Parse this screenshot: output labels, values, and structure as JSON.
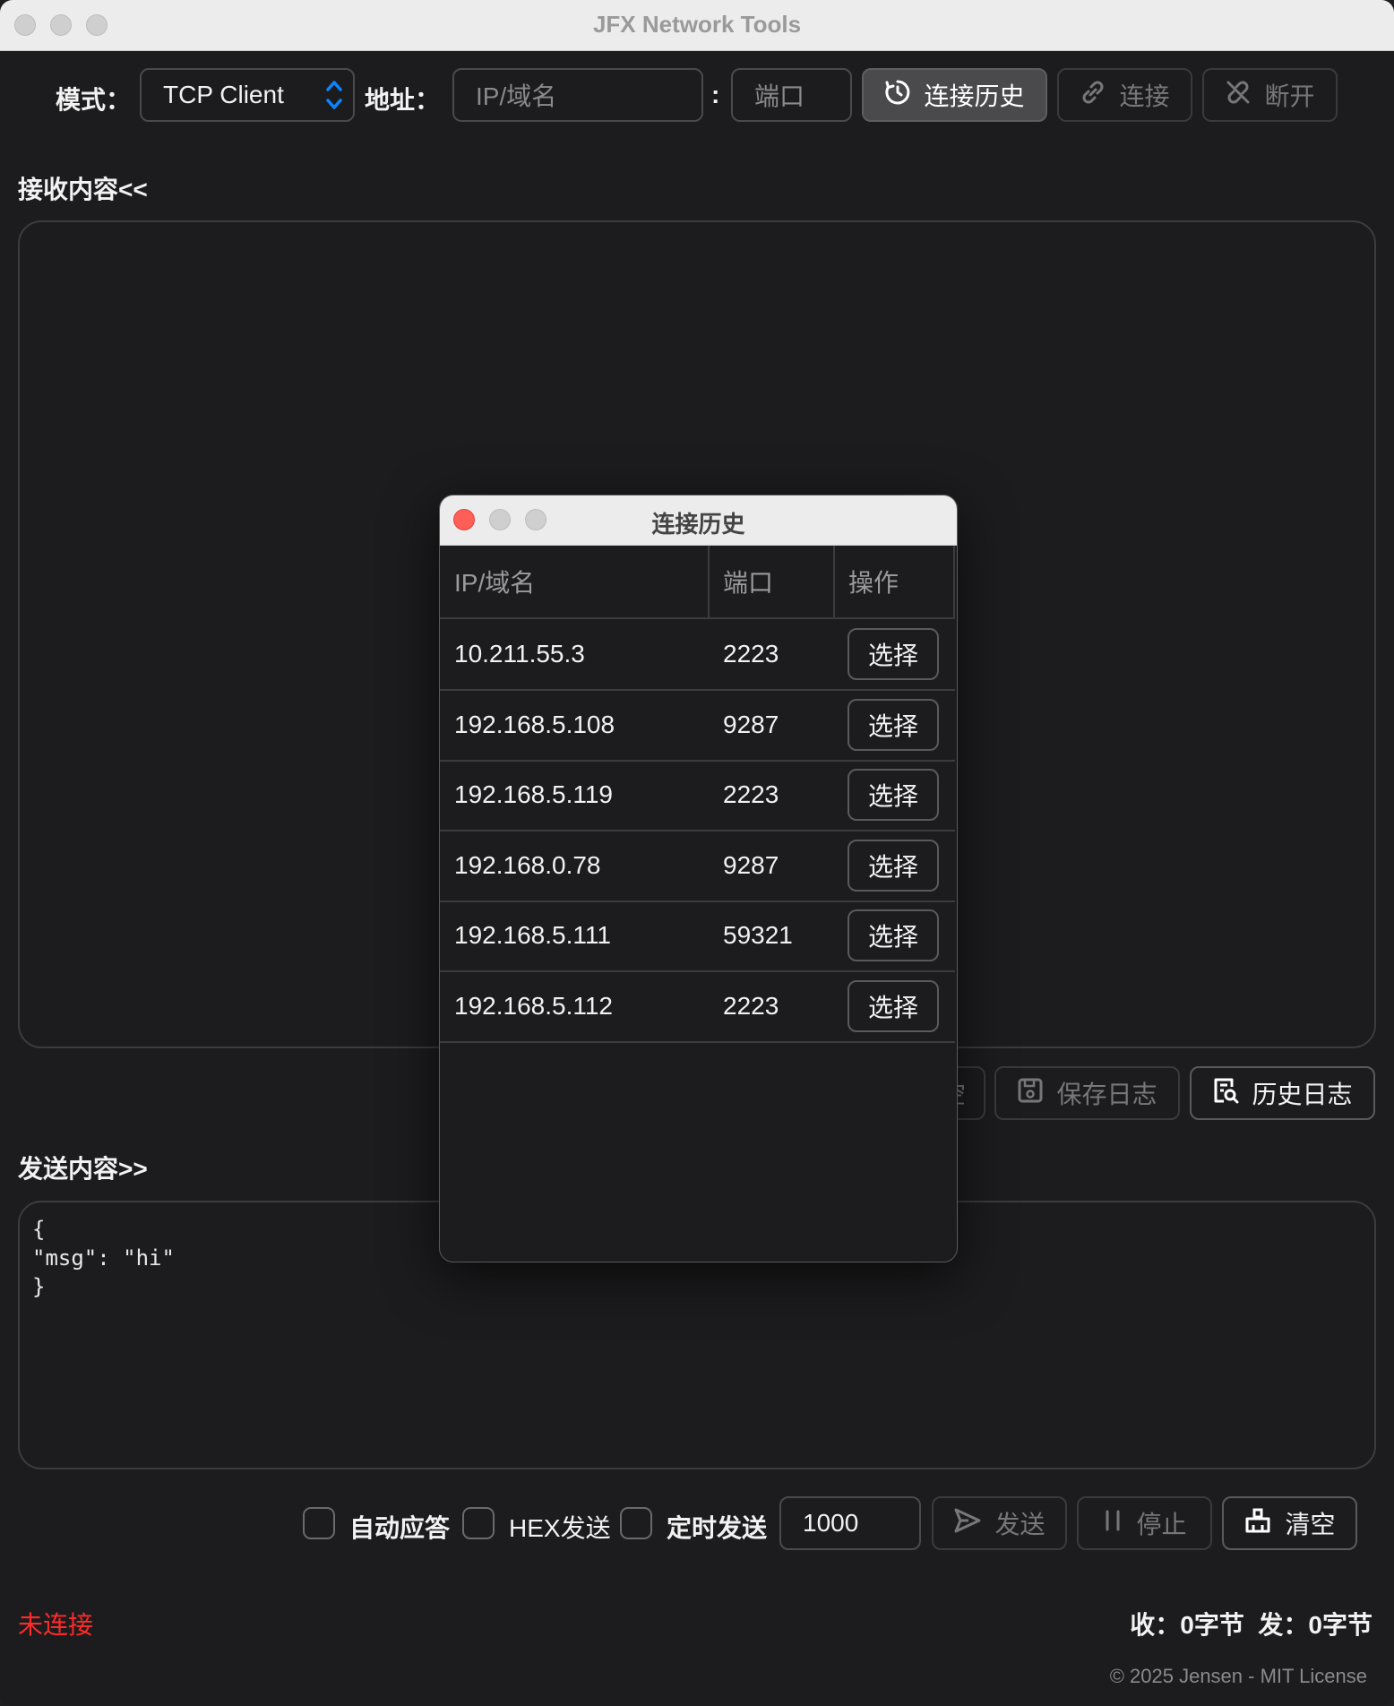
{
  "window": {
    "title": "JFX Network Tools"
  },
  "toolbar": {
    "mode_label": "模式：",
    "mode_value": "TCP Client",
    "address_label": "地址：",
    "host_placeholder": "IP/域名",
    "colon": ":",
    "port_placeholder": "端口",
    "history_button": "连接历史",
    "connect_button": "连接",
    "disconnect_button": "断开"
  },
  "receive": {
    "label": "接收内容<<",
    "content": "",
    "hidden_button_fragment": "空",
    "save_log_button": "保存日志",
    "history_log_button": "历史日志"
  },
  "send": {
    "label": "发送内容>>",
    "content": "{\n\"msg\": \"hi\"\n}",
    "auto_reply_label": "自动应答",
    "hex_send_label": "HEX发送",
    "timed_send_label": "定时发送",
    "interval_value": "1000",
    "send_button": "发送",
    "stop_button": "停止",
    "clear_button": "清空"
  },
  "status": {
    "connection": "未连接",
    "stats": "收：0字节  发：0字节",
    "footer": "© 2025 Jensen - MIT License",
    "connection_color": "#ff2a2a"
  },
  "history_dialog": {
    "title": "连接历史",
    "columns": [
      "IP/域名",
      "端口",
      "操作"
    ],
    "select_label": "选择",
    "rows": [
      {
        "host": "10.211.55.3",
        "port": "2223"
      },
      {
        "host": "192.168.5.108",
        "port": "9287"
      },
      {
        "host": "192.168.5.119",
        "port": "2223"
      },
      {
        "host": "192.168.0.78",
        "port": "9287"
      },
      {
        "host": "192.168.5.111",
        "port": "59321"
      },
      {
        "host": "192.168.5.112",
        "port": "2223"
      }
    ]
  },
  "colors": {
    "background": "#1c1c1e",
    "accent": "#0a84ff",
    "close_red": "#ff5f57"
  }
}
